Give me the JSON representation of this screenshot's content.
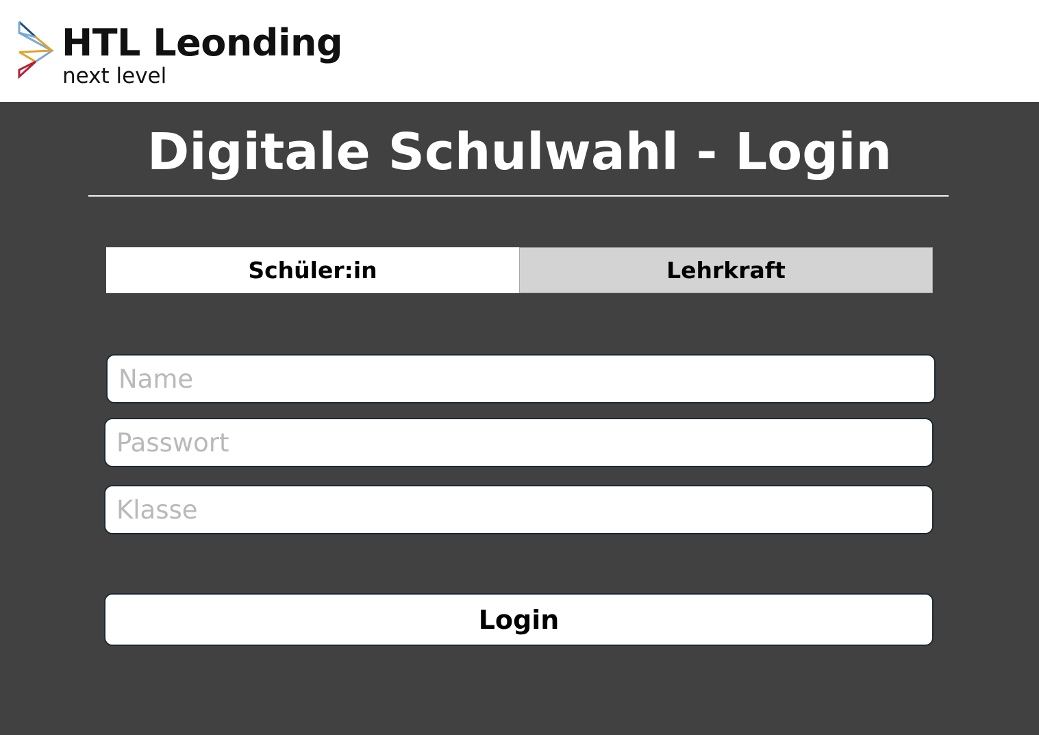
{
  "header": {
    "logo_icon": "htl-chevron-logo-icon",
    "logo_title": "HTL Leonding",
    "logo_subtitle": "next level",
    "logo_colors": [
      "#1f4f7a",
      "#7aa9d6",
      "#e0a32a",
      "#b32232"
    ]
  },
  "main": {
    "title": "Digitale Schulwahl - Login",
    "tabs": [
      {
        "label": "Schüler:in",
        "active": true
      },
      {
        "label": "Lehrkraft",
        "active": false
      }
    ],
    "fields": {
      "name": {
        "placeholder": "Name",
        "value": ""
      },
      "password": {
        "placeholder": "Passwort",
        "value": ""
      },
      "class": {
        "placeholder": "Klasse",
        "value": ""
      }
    },
    "login_label": "Login"
  },
  "colors": {
    "background": "#414141",
    "header_background": "#ffffff",
    "tab_active": "#ffffff",
    "tab_inactive": "#d3d3d3",
    "field_border": "#1b2a33"
  }
}
